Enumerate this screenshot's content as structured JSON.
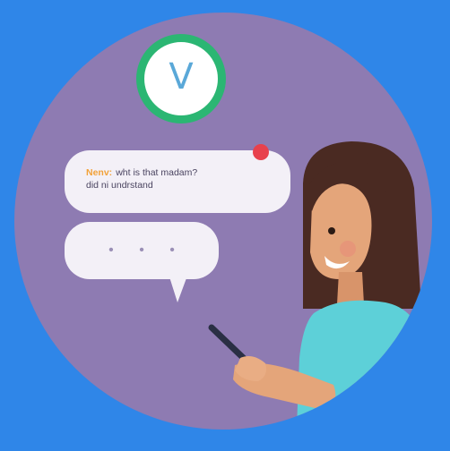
{
  "scene": {
    "colors": {
      "background": "#2f86e8",
      "circle": "#8e7bb2",
      "clock_ring": "#2bb673",
      "bubble": "#f3f0f7",
      "notification": "#e8414d",
      "hair": "#4a2a22",
      "skin": "#e4a57a",
      "shirt": "#5dd0d8"
    },
    "clock": {
      "glyph": "V"
    },
    "message": {
      "sender": "Nenv:",
      "line1": "wht is that madam?",
      "line2": "did ni undrstand"
    },
    "typing": {
      "dots": "• • •"
    },
    "icons": [
      "clock-icon",
      "notification-dot-icon",
      "phone-icon"
    ]
  }
}
